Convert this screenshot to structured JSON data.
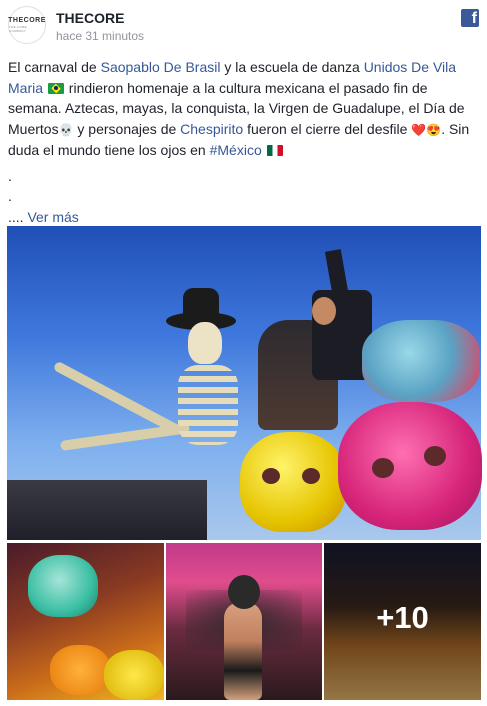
{
  "header": {
    "page_name": "THECORE",
    "timestamp": "hace 31 minutos",
    "avatar_text": "THECORE",
    "avatar_subtext": "THE CORE COMPANY",
    "platform_icon": "facebook-icon"
  },
  "post": {
    "text": {
      "p1_a": "El carnaval de ",
      "link_saopablo": "Saopablo De Brasil",
      "p1_b": " y la escuela de danza ",
      "link_unidos": "Unidos De Vila Maria",
      "p1_c": " rindieron homenaje a la cultura mexicana el pasado fin de semana. Aztecas, mayas, la conquista, la Virgen de Guadalupe, el Día de Muertos",
      "emoji_skull": "💀",
      "p1_d": " y personajes de ",
      "link_chespirito": "Chespirito",
      "p1_e": " fueron el cierre del desfile ",
      "emoji_heart": "❤️",
      "emoji_hearteyes": "😍",
      "p1_f": ". Sin duda el mundo tiene los ojos en ",
      "link_mexico": "#México",
      "dot1": ".",
      "dot2": ".",
      "ellipsis": "....",
      "see_more": "Ver más"
    },
    "flags": [
      "brazil-flag-icon",
      "mexico-flag-icon"
    ],
    "photos": {
      "extra_count": "+10"
    }
  }
}
